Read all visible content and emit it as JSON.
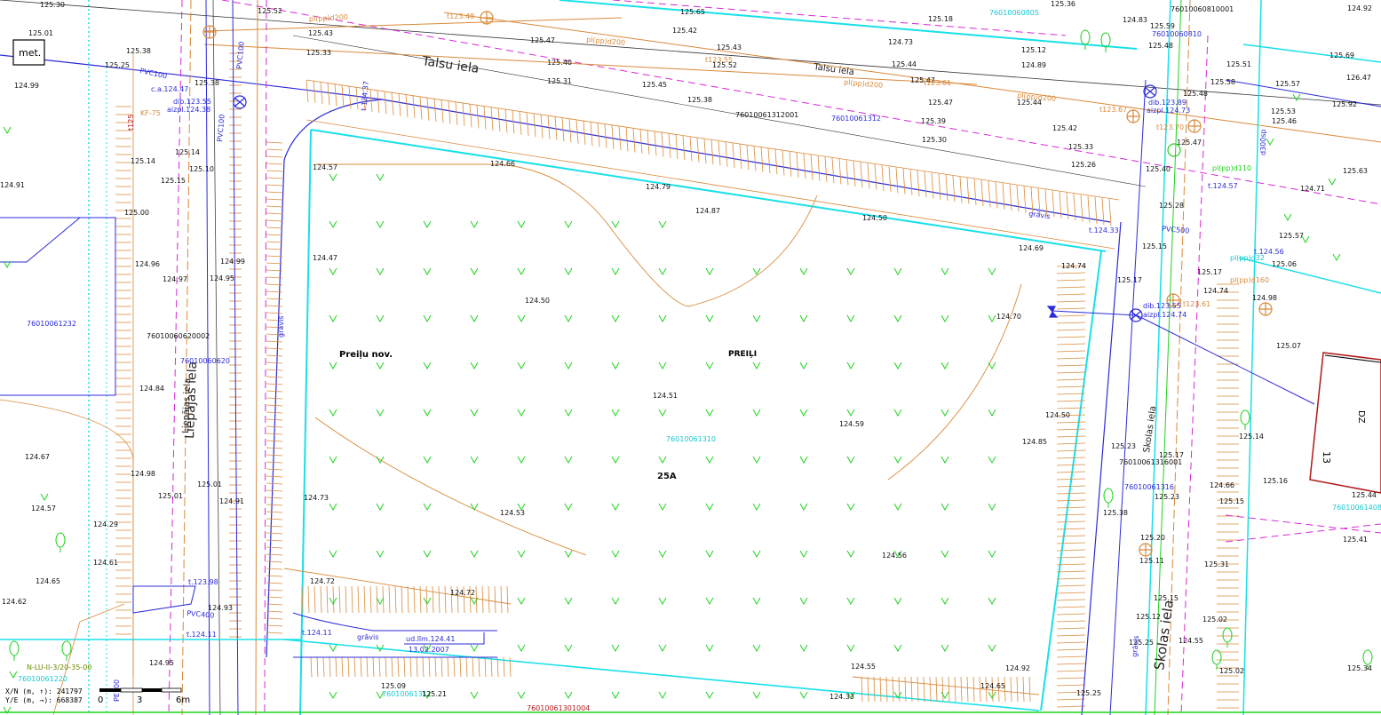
{
  "map": {
    "streets": [
      "Talsu iela",
      "Talsu iela",
      "Skolas iela",
      "Skolas iela",
      "Liepājas iela",
      "Liepājas iela"
    ],
    "places": {
      "municipality": "Preiļu nov.",
      "city": "PREIĻI",
      "house_number": "25A",
      "building_label": "13",
      "building_code": "DZ",
      "building_tag": "met."
    },
    "parcels": [
      "76010061312001",
      "76010061312",
      "76010060810",
      "76010060810001",
      "76010060805",
      "76010061232",
      "76010060620002",
      "76010060620",
      "76010061310",
      "76010061316001",
      "76010061316",
      "76010061408",
      "76010061220",
      "76010061301004",
      "76010061311"
    ],
    "elevations": [
      "125.30",
      "125.52",
      "125.01",
      "125.38",
      "125.25",
      "124.99",
      "125.43",
      "125.33",
      "125.38",
      "125.47",
      "125.40",
      "125.31",
      "125.42",
      "125.43",
      "125.52",
      "125.65",
      "125.36",
      "124.83",
      "125.59",
      "125.48",
      "125.18",
      "124.73",
      "125.12",
      "124.89",
      "125.44",
      "125.47",
      "125.45",
      "125.38",
      "125.47",
      "125.44",
      "125.39",
      "125.42",
      "125.30",
      "125.33",
      "125.26",
      "124.91",
      "125.14",
      "125.15",
      "125.10",
      "125.14",
      "125.00",
      "124.96",
      "124.97",
      "124.99",
      "124.95",
      "124.84",
      "124.67",
      "124.98",
      "125.01",
      "125.01",
      "124.91",
      "124.57",
      "124.29",
      "124.61",
      "124.65",
      "124.62",
      "124.93",
      "124.95",
      "124.57",
      "124.47",
      "124.73",
      "124.72",
      "124.66",
      "124.79",
      "124.87",
      "124.50",
      "124.50",
      "124.72",
      "124.51",
      "124.53",
      "124.59",
      "124.56",
      "124.69",
      "124.74",
      "124.70",
      "124.50",
      "124.85",
      "124.55",
      "124.92",
      "124.65",
      "124.33",
      "125.25",
      "125.09",
      "125.21",
      "125.15",
      "125.17",
      "125.23",
      "125.17",
      "125.23",
      "125.11",
      "125.38",
      "125.20",
      "125.31",
      "125.15",
      "125.12",
      "125.02",
      "125.25",
      "124.55",
      "125.02",
      "125.51",
      "125.58",
      "125.48",
      "125.53",
      "125.46",
      "125.57",
      "125.47",
      "125.40",
      "125.28",
      "125.17",
      "125.06",
      "124.74",
      "124.98",
      "125.07",
      "125.14",
      "125.16",
      "125.15",
      "124.66",
      "125.44",
      "125.41",
      "125.34",
      "124.71",
      "125.57",
      "125.63",
      "125.92",
      "125.69",
      "126.47",
      "124.92"
    ],
    "annotations": {
      "pipes": [
        "pl(pp)d200",
        "pl(pp)d200",
        "pl(pp)d200",
        "pl(pp)d200",
        "PVC100",
        "PVC100",
        "PVC100",
        "PVC400",
        "PVC500",
        "pl(pp)d110",
        "pl(pp)d160",
        "pl(pp)d32",
        "PE100",
        "d300sp"
      ],
      "inverts": [
        "t123.48",
        "t123.55",
        "t123.61",
        "t123.67",
        "t123.70",
        "t.124.37",
        "t.124.33",
        "t.124.57",
        "t.124.56",
        "t.123.98",
        "t.124.11",
        "t.124.11",
        "t123.61"
      ],
      "wells": [
        "c.a.124.47",
        "dib.123.55",
        "aizpl.124.38",
        "dib.123.89",
        "aizpl.124.73",
        "dib.123.55",
        "aizpl.124.74"
      ],
      "ditch": [
        "grāvis",
        "grāvis",
        "grāvis",
        "grāvis"
      ],
      "survey_note": [
        "ud.līm.124.41",
        "13.02.2007"
      ],
      "legend_code": "N-LU-II-3/20-35-00",
      "utility": [
        "KF-75",
        "t125"
      ]
    }
  },
  "footer": {
    "x_label": "X/N (m, ↑): 241797",
    "y_label": "Y/E (m, →): 668387",
    "scale": [
      "0",
      "3",
      "6m"
    ]
  },
  "colors": {
    "orange": "#d98a3a",
    "blue": "#2b2bd9",
    "cyan": "#18e0e8",
    "magenta": "#d629d6",
    "green": "#1fd21f",
    "darkgreen": "#6b8a00"
  }
}
